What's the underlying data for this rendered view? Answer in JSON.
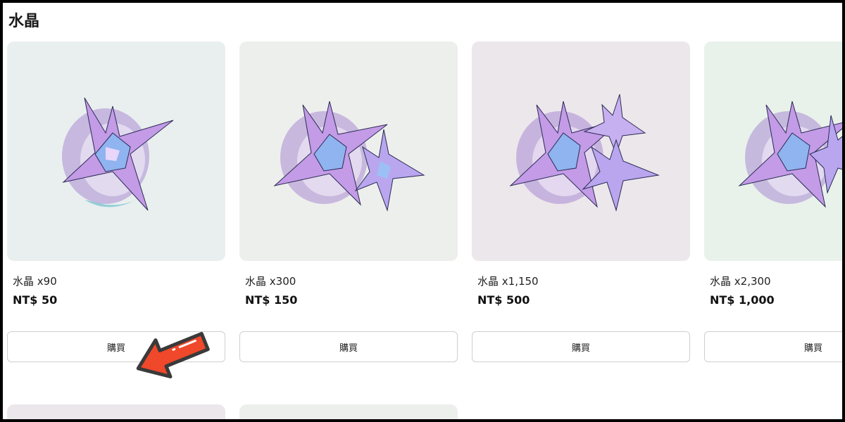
{
  "section": {
    "title": "水晶"
  },
  "products": [
    {
      "name": "水晶 x90",
      "price": "NT$ 50",
      "buy_label": "購買",
      "bg": "#e9efee",
      "crystals": "one"
    },
    {
      "name": "水晶 x300",
      "price": "NT$ 150",
      "buy_label": "購買",
      "bg": "#edefec",
      "crystals": "two"
    },
    {
      "name": "水晶 x1,150",
      "price": "NT$ 500",
      "buy_label": "購買",
      "bg": "#ece7eb",
      "crystals": "three"
    },
    {
      "name": "水晶 x2,300",
      "price": "NT$ 1,000",
      "buy_label": "購買",
      "bg": "#e8f2ea",
      "crystals": "many"
    }
  ],
  "next_row_colors": [
    "#ece7eb",
    "#edefec"
  ],
  "colors": {
    "arrow": "#f0482a",
    "border": "#cfcfcf"
  }
}
